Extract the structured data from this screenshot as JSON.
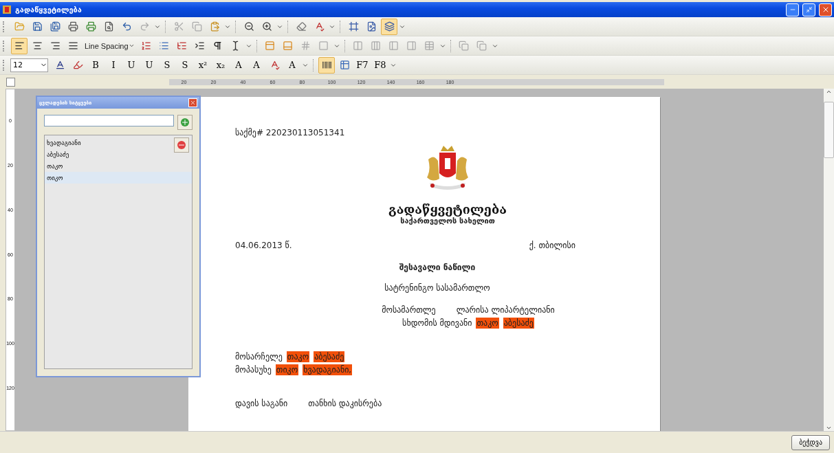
{
  "window": {
    "title": "გადაწყვეტილება"
  },
  "toolbars": [
    {
      "items": [
        {
          "kind": "icon",
          "pressed": false
        },
        {
          "kind": "icon",
          "pressed": false
        },
        {
          "kind": "icon",
          "pressed": false
        },
        {
          "kind": "icon",
          "pressed": false
        },
        {
          "kind": "icon",
          "pressed": false
        },
        {
          "kind": "icon",
          "pressed": false
        },
        {
          "kind": "icon",
          "pressed": false
        },
        {
          "kind": "icon",
          "pressed": false
        },
        {
          "kind": "drop"
        },
        {
          "kind": "sep"
        },
        {
          "kind": "icon",
          "pressed": false
        },
        {
          "kind": "icon",
          "pressed": false
        },
        {
          "kind": "icon",
          "pressed": false
        },
        {
          "kind": "drop"
        },
        {
          "kind": "sep"
        },
        {
          "kind": "icon",
          "pressed": false
        },
        {
          "kind": "icon",
          "pressed": false
        },
        {
          "kind": "drop"
        },
        {
          "kind": "sep"
        },
        {
          "kind": "icon",
          "pressed": false
        },
        {
          "kind": "icon",
          "pressed": false
        },
        {
          "kind": "drop"
        },
        {
          "kind": "sep"
        },
        {
          "kind": "icon",
          "pressed": false
        },
        {
          "kind": "icon",
          "pressed": false
        },
        {
          "kind": "icon",
          "pressed": true
        },
        {
          "kind": "drop"
        }
      ]
    },
    {
      "items": [
        {
          "kind": "icon",
          "pressed": true
        },
        {
          "kind": "icon",
          "pressed": false
        },
        {
          "kind": "icon",
          "pressed": false
        },
        {
          "kind": "icon",
          "pressed": false
        },
        {
          "kind": "text",
          "label": "Line Spacing"
        },
        {
          "kind": "icon",
          "pressed": false
        },
        {
          "kind": "icon",
          "pressed": false
        },
        {
          "kind": "icon",
          "pressed": false
        },
        {
          "kind": "icon",
          "pressed": false
        },
        {
          "kind": "icon",
          "pressed": false
        },
        {
          "kind": "icon",
          "pressed": false
        },
        {
          "kind": "drop"
        },
        {
          "kind": "sep"
        },
        {
          "kind": "icon",
          "pressed": false
        },
        {
          "kind": "icon",
          "pressed": false
        },
        {
          "kind": "icon",
          "pressed": false
        },
        {
          "kind": "icon",
          "pressed": false
        },
        {
          "kind": "drop"
        },
        {
          "kind": "sep"
        },
        {
          "kind": "icon",
          "pressed": false
        },
        {
          "kind": "icon",
          "pressed": false
        },
        {
          "kind": "icon",
          "pressed": false
        },
        {
          "kind": "icon",
          "pressed": false
        },
        {
          "kind": "icon",
          "pressed": false
        },
        {
          "kind": "drop"
        },
        {
          "kind": "sep"
        },
        {
          "kind": "icon",
          "pressed": false
        },
        {
          "kind": "icon",
          "pressed": false
        },
        {
          "kind": "drop"
        }
      ]
    },
    {
      "items": [
        {
          "kind": "combo",
          "label": "12"
        },
        {
          "kind": "icon",
          "pressed": false
        },
        {
          "kind": "icon",
          "pressed": false
        },
        {
          "kind": "glyph",
          "label": "B",
          "pressed": false
        },
        {
          "kind": "glyph",
          "label": "I",
          "pressed": false
        },
        {
          "kind": "glyph",
          "label": "U",
          "pressed": false
        },
        {
          "kind": "glyph",
          "label": "U",
          "pressed": false
        },
        {
          "kind": "glyph",
          "label": "S",
          "pressed": false
        },
        {
          "kind": "glyph",
          "label": "S",
          "pressed": false
        },
        {
          "kind": "glyph",
          "label": "x²",
          "pressed": false
        },
        {
          "kind": "glyph",
          "label": "x₂",
          "pressed": false
        },
        {
          "kind": "glyph",
          "label": "A",
          "pressed": false
        },
        {
          "kind": "glyph",
          "label": "A",
          "pressed": false
        },
        {
          "kind": "icon",
          "pressed": false
        },
        {
          "kind": "glyph",
          "label": "A",
          "pressed": false
        },
        {
          "kind": "drop"
        },
        {
          "kind": "sep"
        },
        {
          "kind": "icon",
          "pressed": true
        },
        {
          "kind": "icon",
          "pressed": false
        },
        {
          "kind": "glyph",
          "label": "F7",
          "pressed": false
        },
        {
          "kind": "glyph",
          "label": "F8",
          "pressed": false
        },
        {
          "kind": "drop"
        }
      ]
    }
  ],
  "ruler": {
    "horizontal": [
      "20",
      "20",
      "40",
      "60",
      "80",
      "100",
      "120",
      "140",
      "160",
      "180"
    ],
    "vertical": [
      "0",
      "20",
      "40",
      "60",
      "80",
      "100",
      "120"
    ]
  },
  "words_panel": {
    "title": "ცვლადების სიტყვები",
    "items": [
      {
        "label": "ხვადაგიანი",
        "selected": false
      },
      {
        "label": "აბესაძე",
        "selected": false
      },
      {
        "label": "თაკო",
        "selected": false
      },
      {
        "label": "თიკო",
        "selected": true
      }
    ]
  },
  "document": {
    "case_number": "საქმე#  220230113051341",
    "title": "გადაწყვეტილება",
    "subtitle": "საქართველოს სახელით",
    "date": "04.06.2013 წ.",
    "city": "ქ. თბილისი",
    "section": "შესავალი ნაწილი",
    "court": "სატრენინგო სასამართლო",
    "lines": [
      {
        "kind": "center",
        "parts": [
          {
            "text": "მოსამართლე",
            "highlighted": false
          },
          {
            "text": "ლარისა ლიპარტელიანი",
            "highlighted": false
          }
        ]
      },
      {
        "kind": "center",
        "parts": [
          {
            "text": "სხდომის მდივანი",
            "highlighted": false
          },
          {
            "text": "თაკო",
            "highlighted": true
          },
          {
            "text": "აბესაძე",
            "highlighted": true
          }
        ]
      },
      {
        "kind": "gap"
      },
      {
        "kind": "left",
        "parts": [
          {
            "text": "მოსარჩელე",
            "highlighted": false
          },
          {
            "text": "თაკო",
            "highlighted": true
          },
          {
            "text": "აბესაძე",
            "highlighted": true
          }
        ]
      },
      {
        "kind": "left",
        "parts": [
          {
            "text": "მოპასუხე",
            "highlighted": false
          },
          {
            "text": "თიკო",
            "highlighted": true
          },
          {
            "text": "ხვადაგიანი,",
            "highlighted": true
          }
        ]
      },
      {
        "kind": "gap"
      },
      {
        "kind": "left",
        "parts": [
          {
            "text": "დავის საგანი",
            "highlighted": false
          },
          {
            "text": "თანხის დაკისრება",
            "highlighted": false
          }
        ]
      }
    ]
  },
  "status_bar": {
    "button": "ბეჭდვა"
  }
}
